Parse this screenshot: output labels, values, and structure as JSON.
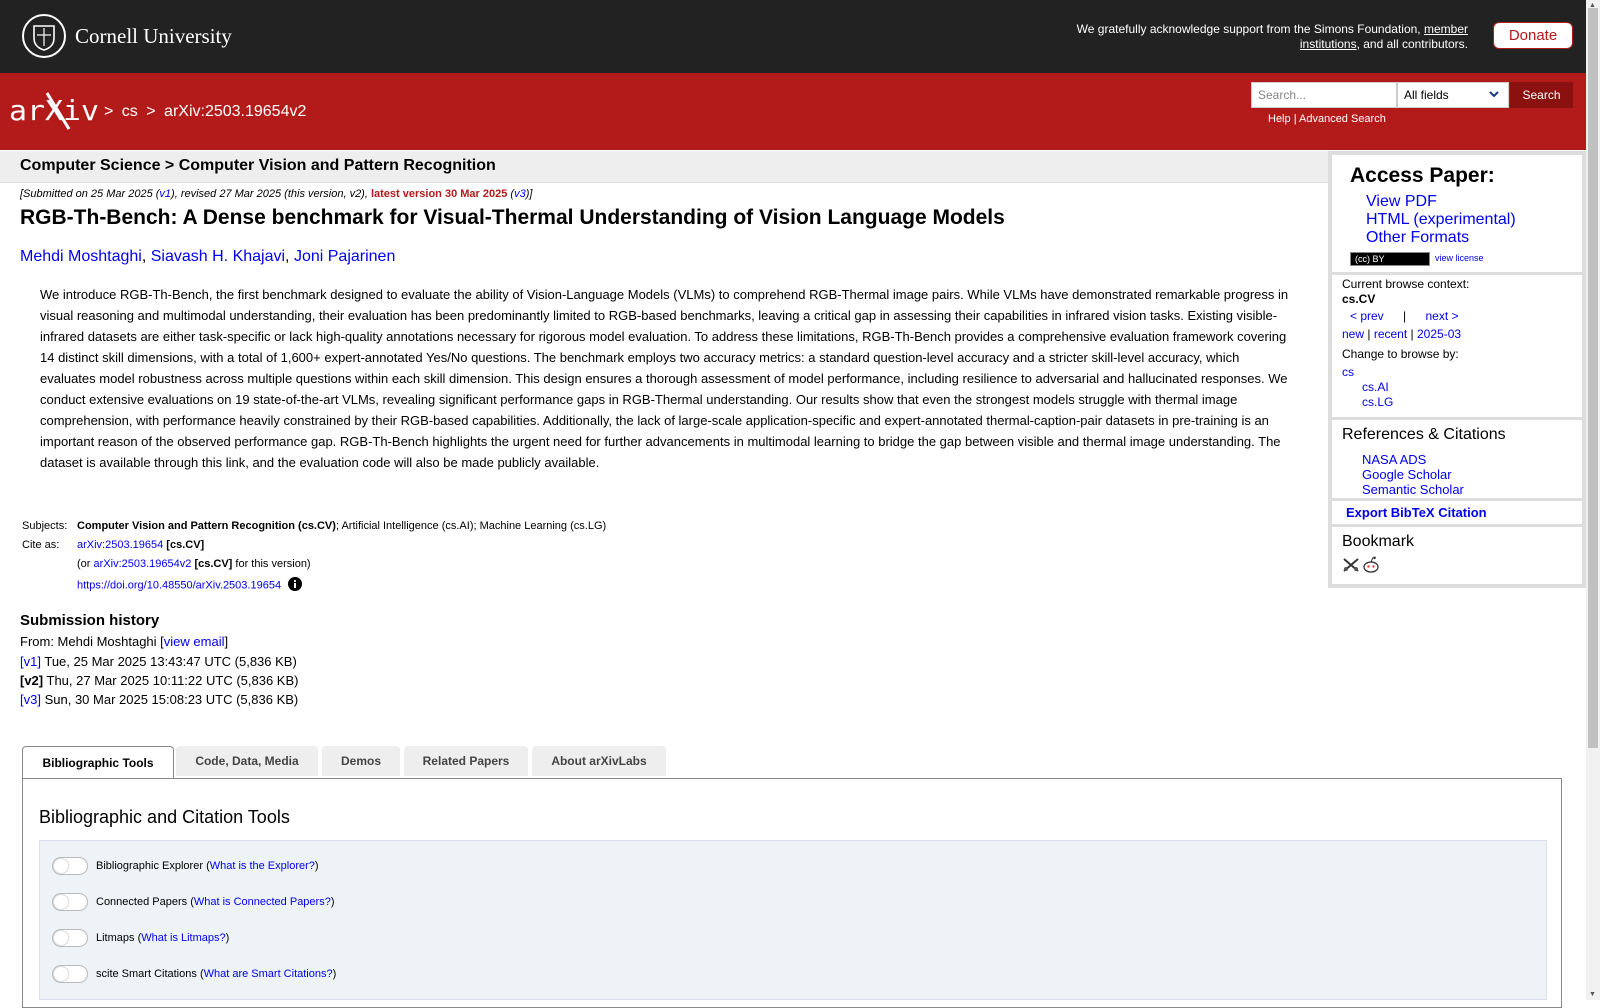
{
  "topbar": {
    "logo_text": "Cornell University",
    "ack_text": "We gratefully acknowledge support from the Simons Foundation,",
    "ack_link": "member institutions",
    "ack_tail": ", and all contributors.",
    "donate_label": "Donate"
  },
  "header": {
    "logo_text": "arXiv",
    "breadcrumbs": [
      ">",
      "cs",
      ">",
      "arXiv:2503.19654v2"
    ],
    "search_placeholder": "Search...",
    "search_field": "All fields",
    "search_button": "Search",
    "help_link": "Help",
    "separator": "|",
    "advanced_link": "Advanced Search"
  },
  "subheader": "Computer Science > Computer Vision and Pattern Recognition",
  "dateline": {
    "prefix": "[Submitted on 25 Mar 2025 (",
    "v1": "v1",
    "mid": "), revised 27 Mar 2025 (this version, v2),",
    "latest": "latest version 30 Mar 2025",
    "open": "(",
    "v3": "v3",
    "close": ")]"
  },
  "paper": {
    "title": "RGB-Th-Bench: A Dense benchmark for Visual-Thermal Understanding of Vision Language Models",
    "authors": [
      "Mehdi Moshtaghi",
      "Siavash H. Khajavi",
      "Joni Pajarinen"
    ],
    "author_sep": ",",
    "abstract": "We introduce RGB-Th-Bench, the first benchmark designed to evaluate the ability of Vision-Language Models (VLMs) to comprehend RGB-Thermal image pairs. While VLMs have demonstrated remarkable progress in visual reasoning and multimodal understanding, their evaluation has been predominantly limited to RGB-based benchmarks, leaving a critical gap in assessing their capabilities in infrared vision tasks. Existing visible-infrared datasets are either task-specific or lack high-quality annotations necessary for rigorous model evaluation. To address these limitations, RGB-Th-Bench provides a comprehensive evaluation framework covering 14 distinct skill dimensions, with a total of 1,600+ expert-annotated Yes/No questions. The benchmark employs two accuracy metrics: a standard question-level accuracy and a stricter skill-level accuracy, which evaluates model robustness across multiple questions within each skill dimension. This design ensures a thorough assessment of model performance, including resilience to adversarial and hallucinated responses. We conduct extensive evaluations on 19 state-of-the-art VLMs, revealing significant performance gaps in RGB-Thermal understanding. Our results show that even the strongest models struggle with thermal image comprehension, with performance heavily constrained by their RGB-based capabilities. Additionally, the lack of large-scale application-specific and expert-annotated thermal-caption-pair datasets in pre-training is an important reason of the observed performance gap. RGB-Th-Bench highlights the urgent need for further advancements in multimodal learning to bridge the gap between visible and thermal image understanding. The dataset is available through this link, and the evaluation code will also be made publicly available."
  },
  "metadata": {
    "subjects_label": "Subjects:",
    "subjects_primary": "Computer Vision and Pattern Recognition (cs.CV)",
    "subjects_rest": "; Artificial Intelligence (cs.AI); Machine Learning (cs.LG)",
    "cite_label": "Cite as:",
    "cite_id": "arXiv:2503.19654",
    "cite_tag": "[cs.CV]",
    "cite_version_prefix": "(or",
    "cite_version_id": "arXiv:2503.19654v2",
    "cite_version_tag": "[cs.CV]",
    "cite_version_suffix": "for this version)",
    "doi": "https://doi.org/10.48550/arXiv.2503.19654"
  },
  "history": {
    "heading": "Submission history",
    "from_prefix": "From: Mehdi Moshtaghi [",
    "view_email": "view email",
    "from_suffix": "]",
    "versions": [
      {
        "tag": "[v1]",
        "text": "Tue, 25 Mar 2025 13:43:47 UTC (5,836 KB)"
      },
      {
        "tag": "[v2]",
        "text": "Thu, 27 Mar 2025 10:11:22 UTC (5,836 KB)"
      },
      {
        "tag": "[v3]",
        "text": "Sun, 30 Mar 2025 15:08:23 UTC (5,836 KB)"
      }
    ]
  },
  "tabs": [
    "Bibliographic Tools",
    "Code, Data, Media",
    "Demos",
    "Related Papers",
    "About arXivLabs"
  ],
  "panel": {
    "title": "Bibliographic and Citation Tools",
    "tools": [
      {
        "name": "Bibliographic Explorer",
        "help": "What is the Explorer?"
      },
      {
        "name": "Connected Papers",
        "help": "What is Connected Papers?"
      },
      {
        "name": "Litmaps",
        "help": "What is Litmaps?"
      },
      {
        "name": "scite Smart Citations",
        "help": "What are Smart Citations?"
      }
    ],
    "open_paren": "(",
    "close_paren": ")"
  },
  "sidebar": {
    "access_title": "Access Paper:",
    "view_pdf": "View PDF",
    "html": "HTML (experimental)",
    "other_formats": "Other Formats",
    "cc_badge": "(cc) BY",
    "view_license": "view license",
    "context_label": "Current browse context:",
    "context_value": "cs.CV",
    "prev": "< prev",
    "pipe": "|",
    "next": "next >",
    "new": "new",
    "recent": "recent",
    "month": "2025-03",
    "change_label": "Change to browse by:",
    "browse_cs": "cs",
    "browse_ai": "cs.AI",
    "browse_lg": "cs.LG",
    "refs_title": "References & Citations",
    "nasa": "NASA ADS",
    "google": "Google Scholar",
    "semantic": "Semantic Scholar",
    "export": "Export BibTeX Citation",
    "bookmark": "Bookmark"
  }
}
